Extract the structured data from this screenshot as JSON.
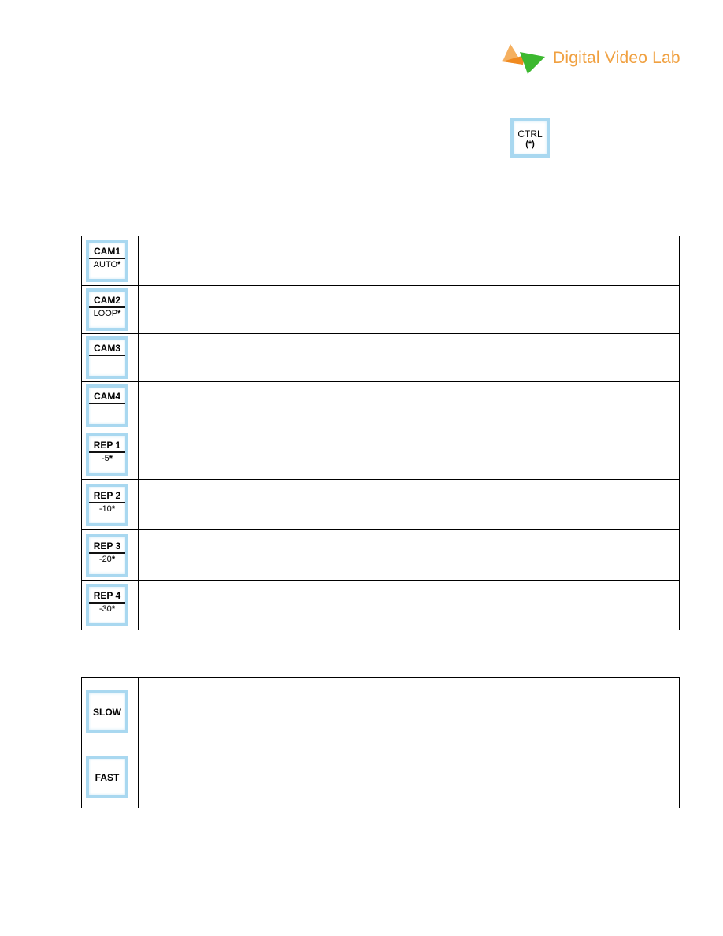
{
  "logo": {
    "text": "Digital Video Lab",
    "colors": {
      "orange": "#f0a040",
      "green": "#3cb830"
    }
  },
  "ctrl_key": {
    "top": "CTRL",
    "bottom": "(*)"
  },
  "table1": [
    {
      "top": "CAM1",
      "bottom": "AUTO",
      "star": "*",
      "description": ""
    },
    {
      "top": "CAM2",
      "bottom": "LOOP",
      "star": "*",
      "description": ""
    },
    {
      "top": "CAM3",
      "bottom": "",
      "star": "",
      "description": ""
    },
    {
      "top": "CAM4",
      "bottom": "",
      "star": "",
      "description": ""
    },
    {
      "top": "REP 1",
      "bottom": "-5",
      "star": "*",
      "description": ""
    },
    {
      "top": "REP 2",
      "bottom": "-10",
      "star": "*",
      "description": ""
    },
    {
      "top": "REP 3",
      "bottom": "-20",
      "star": "*",
      "description": ""
    },
    {
      "top": "REP 4",
      "bottom": "-30",
      "star": "*",
      "description": ""
    }
  ],
  "table2": [
    {
      "label": "SLOW",
      "description": ""
    },
    {
      "label": "FAST",
      "description": ""
    }
  ],
  "key_border_color": "#a9d8f0"
}
